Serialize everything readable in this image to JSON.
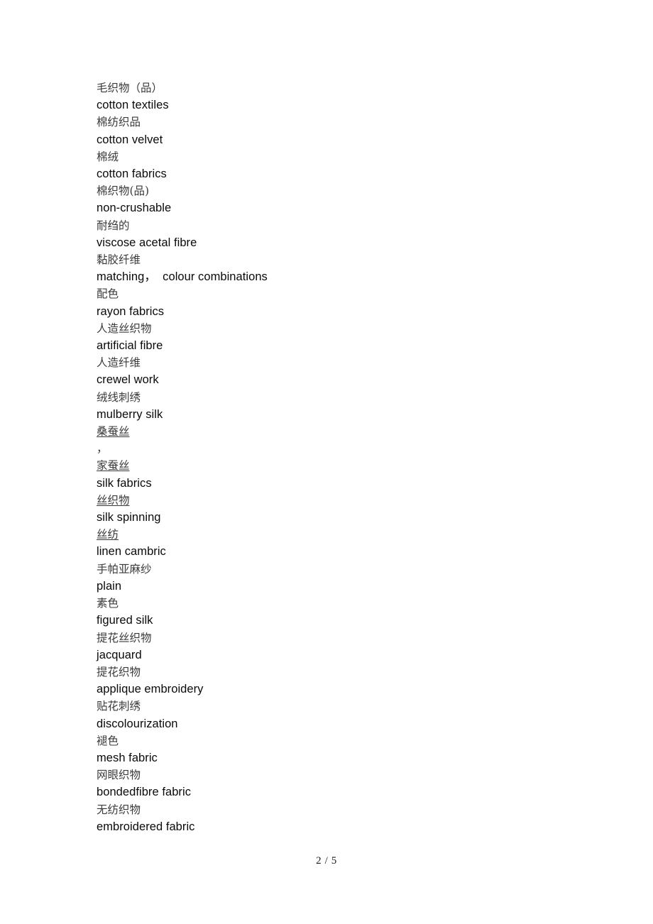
{
  "document": {
    "lines": [
      {
        "text": "毛织物（品）",
        "lang": "zh",
        "underline": false
      },
      {
        "text": "cotton textiles",
        "lang": "en",
        "underline": false
      },
      {
        "text": "棉纺织品",
        "lang": "zh",
        "underline": false
      },
      {
        "text": "cotton velvet",
        "lang": "en",
        "underline": false
      },
      {
        "text": "棉绒",
        "lang": "zh",
        "underline": false
      },
      {
        "text": "cotton fabrics",
        "lang": "en",
        "underline": false
      },
      {
        "text": "棉织物(品)",
        "lang": "zh",
        "underline": false
      },
      {
        "text": "non-crushable",
        "lang": "en",
        "underline": false
      },
      {
        "text": "耐绉的",
        "lang": "zh",
        "underline": false
      },
      {
        "text": "viscose acetal fibre",
        "lang": "en",
        "underline": false
      },
      {
        "text": "黏胶纤维",
        "lang": "zh",
        "underline": false
      },
      {
        "text": "matching，  colour combinations",
        "lang": "en",
        "underline": false
      },
      {
        "text": "配色",
        "lang": "zh",
        "underline": false
      },
      {
        "text": "rayon fabrics",
        "lang": "en",
        "underline": false
      },
      {
        "text": "人造丝织物",
        "lang": "zh",
        "underline": false
      },
      {
        "text": "artificial fibre",
        "lang": "en",
        "underline": false
      },
      {
        "text": "人造纤维",
        "lang": "zh",
        "underline": false
      },
      {
        "text": "crewel work",
        "lang": "en",
        "underline": false
      },
      {
        "text": "绒线刺绣",
        "lang": "zh",
        "underline": false
      },
      {
        "text": "mulberry silk",
        "lang": "en",
        "underline": false
      },
      {
        "text": "桑蚕丝",
        "lang": "zh",
        "underline": true
      },
      {
        "text": "，",
        "lang": "punct",
        "underline": false
      },
      {
        "text": "家蚕丝",
        "lang": "zh",
        "underline": true
      },
      {
        "text": "silk fabrics",
        "lang": "en",
        "underline": false
      },
      {
        "text": "丝织物",
        "lang": "zh",
        "underline": true
      },
      {
        "text": "silk spinning",
        "lang": "en",
        "underline": false
      },
      {
        "text": "丝纺",
        "lang": "zh",
        "underline": true
      },
      {
        "text": "linen cambric",
        "lang": "en",
        "underline": false
      },
      {
        "text": "手帕亚麻纱",
        "lang": "zh",
        "underline": false
      },
      {
        "text": "plain",
        "lang": "en",
        "underline": false
      },
      {
        "text": "素色",
        "lang": "zh",
        "underline": false
      },
      {
        "text": "figured silk",
        "lang": "en",
        "underline": false
      },
      {
        "text": "提花丝织物",
        "lang": "zh",
        "underline": false
      },
      {
        "text": "jacquard",
        "lang": "en",
        "underline": false
      },
      {
        "text": "提花织物",
        "lang": "zh",
        "underline": false
      },
      {
        "text": "applique embroidery",
        "lang": "en",
        "underline": false
      },
      {
        "text": "贴花刺绣",
        "lang": "zh",
        "underline": false
      },
      {
        "text": "discolourization",
        "lang": "en",
        "underline": false
      },
      {
        "text": "褪色",
        "lang": "zh",
        "underline": false
      },
      {
        "text": "mesh fabric",
        "lang": "en",
        "underline": false
      },
      {
        "text": "网眼织物",
        "lang": "zh",
        "underline": false
      },
      {
        "text": "bondedfibre fabric",
        "lang": "en",
        "underline": false
      },
      {
        "text": "无纺织物",
        "lang": "zh",
        "underline": false
      },
      {
        "text": "embroidered fabric",
        "lang": "en",
        "underline": false
      }
    ],
    "footer": "2 / 5"
  }
}
